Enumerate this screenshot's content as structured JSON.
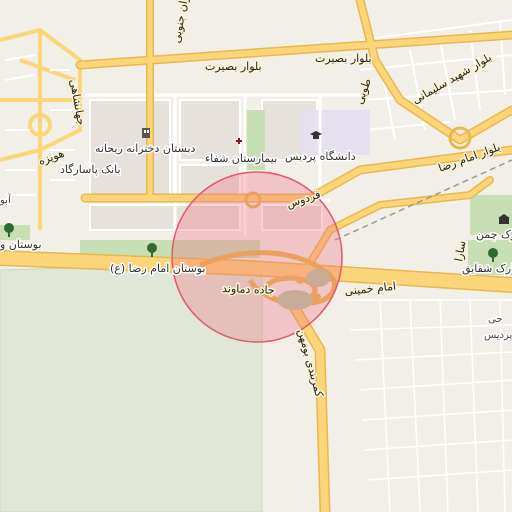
{
  "map": {
    "roads": {
      "boulevard_basirat_left": "بلوار بصیرت",
      "boulevard_basirat_right": "بلوار بصیرت",
      "boulevard_shahid_soleimani": "بلوار شهید سلیمانی",
      "boulevard_janbazan": "بلوار جانبازان جنوبی",
      "boulevard_imam_reza": "بلوار امام رضا",
      "ferdows": "فردوس",
      "tubi": "طوبی",
      "imam_khomeini": "امام خمینی",
      "damavand_road": "جاده دماوند",
      "bumehen_beltway": "کمربندی بومهن",
      "sareh": "سارا",
      "huvayzeh": "هویزه",
      "jahanshahi": "جهانشاهی"
    },
    "pois": {
      "imam_reza_park": "بوستان امام رضا (ع)",
      "varzesh_park": "بوستان و",
      "daneshgah_pardis": "دانشگاه پردیس",
      "bimarestan_shafa": "بیمارستان شفاء",
      "dabestan_reyhaneh": "دبستان دخترانه ریحانه",
      "bank_pasargad": "بانک پاسارگاد",
      "park_chaman": "پارک چمن",
      "park_shaqayeq": "پارک شقایق",
      "pardis_label": "پردیس",
      "pardis_prefix": "حی",
      "left_edge_label": "آبو"
    },
    "colors": {
      "background": "#f2efe9",
      "road_major": "#fbd57a",
      "road_casing": "#e8b84e",
      "road_minor": "#ffffff",
      "circle_fill": "#ee6e7e",
      "green": "#c8dfb5",
      "large_field": "#e0e7d6"
    },
    "icons": [
      "hospital-icon",
      "school-icon",
      "university-icon",
      "tree-icon",
      "bank-icon"
    ]
  }
}
